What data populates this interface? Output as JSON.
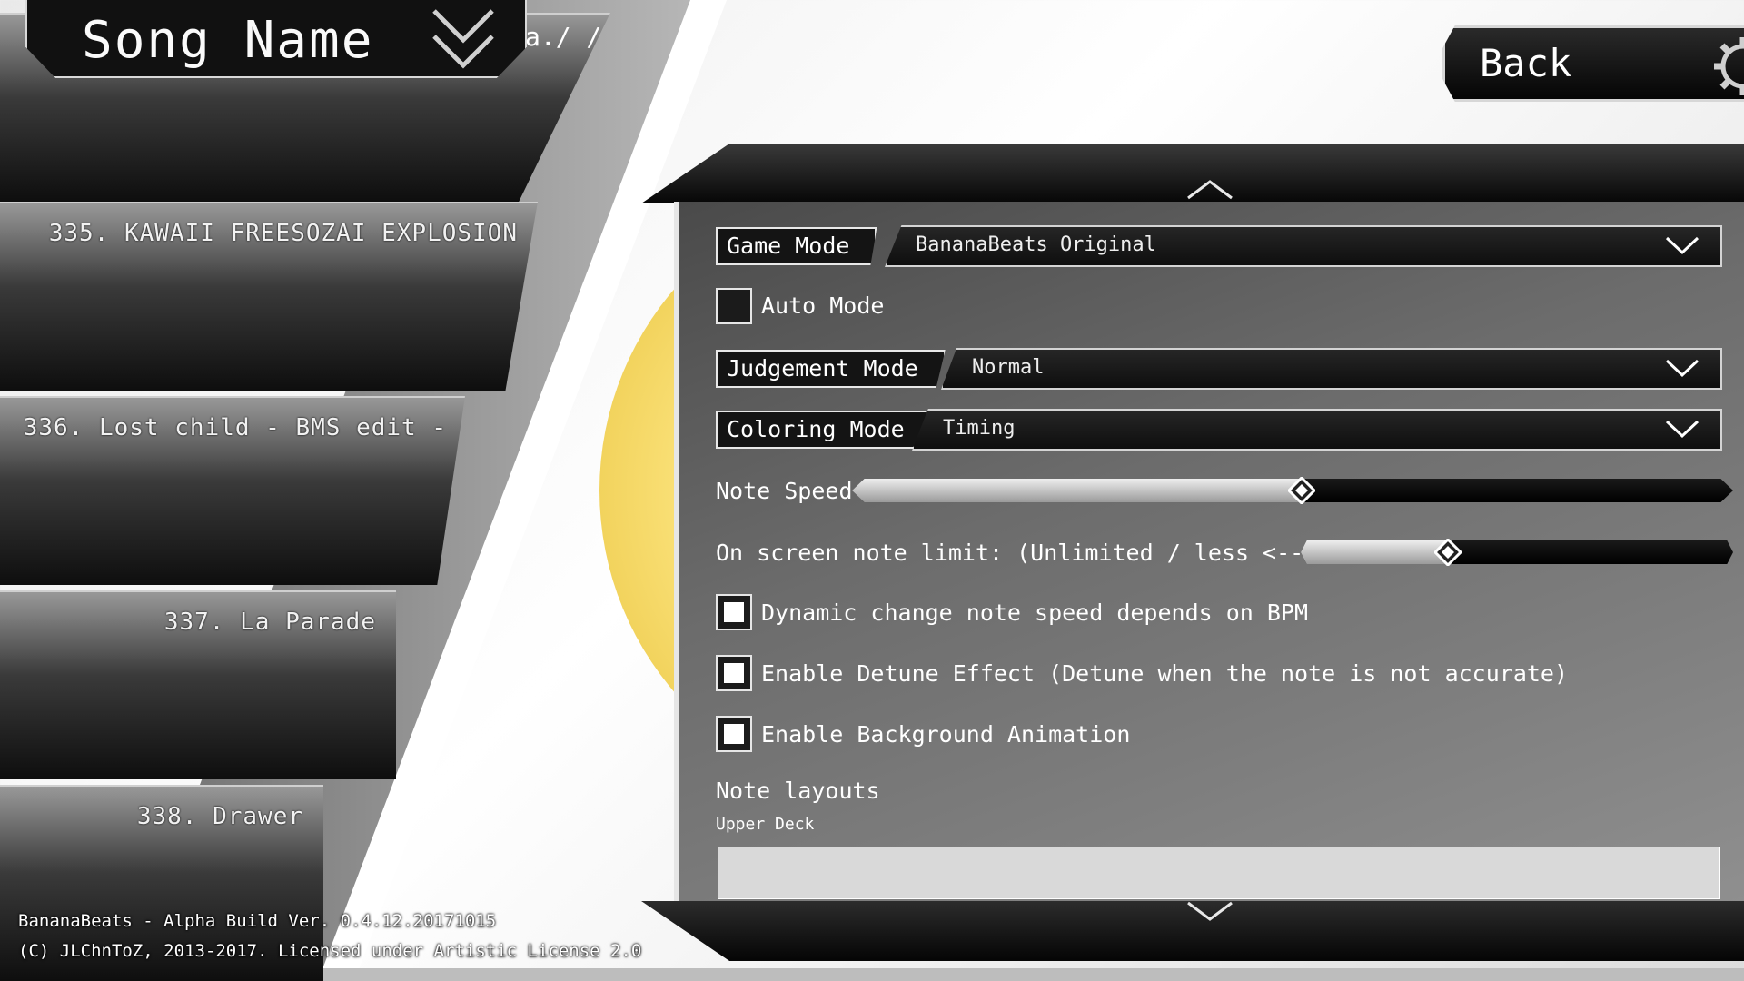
{
  "header": {
    "song_name": "Song Name",
    "partial_text": "a./ /"
  },
  "songs": [
    {
      "label": "335. KAWAII FREESOZAI EXPLOSION"
    },
    {
      "label": "336. Lost child - BMS edit -"
    },
    {
      "label": "337. La Parade"
    },
    {
      "label": "338. Drawer"
    }
  ],
  "footer": {
    "line1": "BananaBeats - Alpha Build Ver. 0.4.12.20171015",
    "line2": "(C) JLChnToZ, 2013-2017. Licensed under Artistic License 2.0"
  },
  "back_button": {
    "label": "Back"
  },
  "settings": {
    "game_mode": {
      "label": "Game Mode",
      "value": "BananaBeats Original"
    },
    "auto_mode": {
      "label": "Auto Mode",
      "checked": false
    },
    "judgement_mode": {
      "label": "Judgement Mode",
      "value": "Normal"
    },
    "coloring_mode": {
      "label": "Coloring Mode",
      "value": "Timing"
    },
    "note_speed": {
      "label": "Note Speed",
      "fraction": 0.51
    },
    "note_limit": {
      "label": "On screen note limit: (Unlimited / less <--> more)",
      "fraction": 0.34
    },
    "dynamic_speed": {
      "label": "Dynamic change note speed depends on BPM",
      "checked": true
    },
    "detune": {
      "label": "Enable Detune Effect (Detune when the note is not accurate)",
      "checked": true
    },
    "bg_animation": {
      "label": "Enable Background Animation",
      "checked": true
    },
    "note_layouts": {
      "title": "Note layouts",
      "subtitle": "Upper Deck"
    }
  },
  "colors": {
    "panel_dark": "#0e0e0e",
    "accent_yellow": "#f5d76e",
    "track_fill": "#dddddd"
  },
  "icons": [
    "chevron-down-icon",
    "gear-icon",
    "chevron-up-icon",
    "diamond-thumb-icon"
  ]
}
